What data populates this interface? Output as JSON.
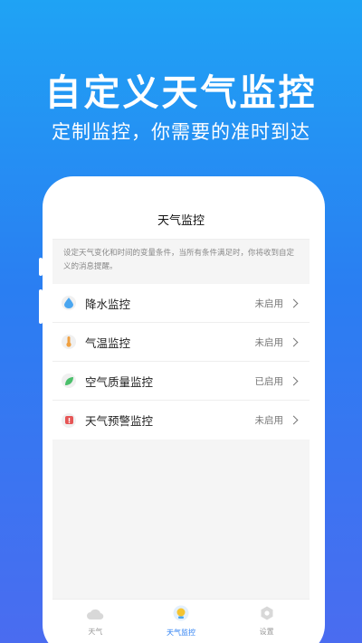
{
  "hero": {
    "title": "自定义天气监控",
    "subtitle": "定制监控，你需要的准时到达"
  },
  "app": {
    "title": "天气监控",
    "description": "设定天气变化和时间的变量条件，当所有条件满足时，你将收到自定义的消息提醒。",
    "items": [
      {
        "label": "降水监控",
        "status": "未启用",
        "icon": "raindrop-icon",
        "color": "#4aa6f0"
      },
      {
        "label": "气温监控",
        "status": "未启用",
        "icon": "thermometer-icon",
        "color": "#f0a040"
      },
      {
        "label": "空气质量监控",
        "status": "已启用",
        "icon": "leaf-icon",
        "color": "#4bbf6b"
      },
      {
        "label": "天气预警监控",
        "status": "未启用",
        "icon": "warning-icon",
        "color": "#e65555"
      }
    ],
    "tabs": [
      {
        "label": "天气",
        "icon": "cloud-icon"
      },
      {
        "label": "天气监控",
        "icon": "monitor-icon"
      },
      {
        "label": "设置",
        "icon": "settings-icon"
      }
    ]
  }
}
